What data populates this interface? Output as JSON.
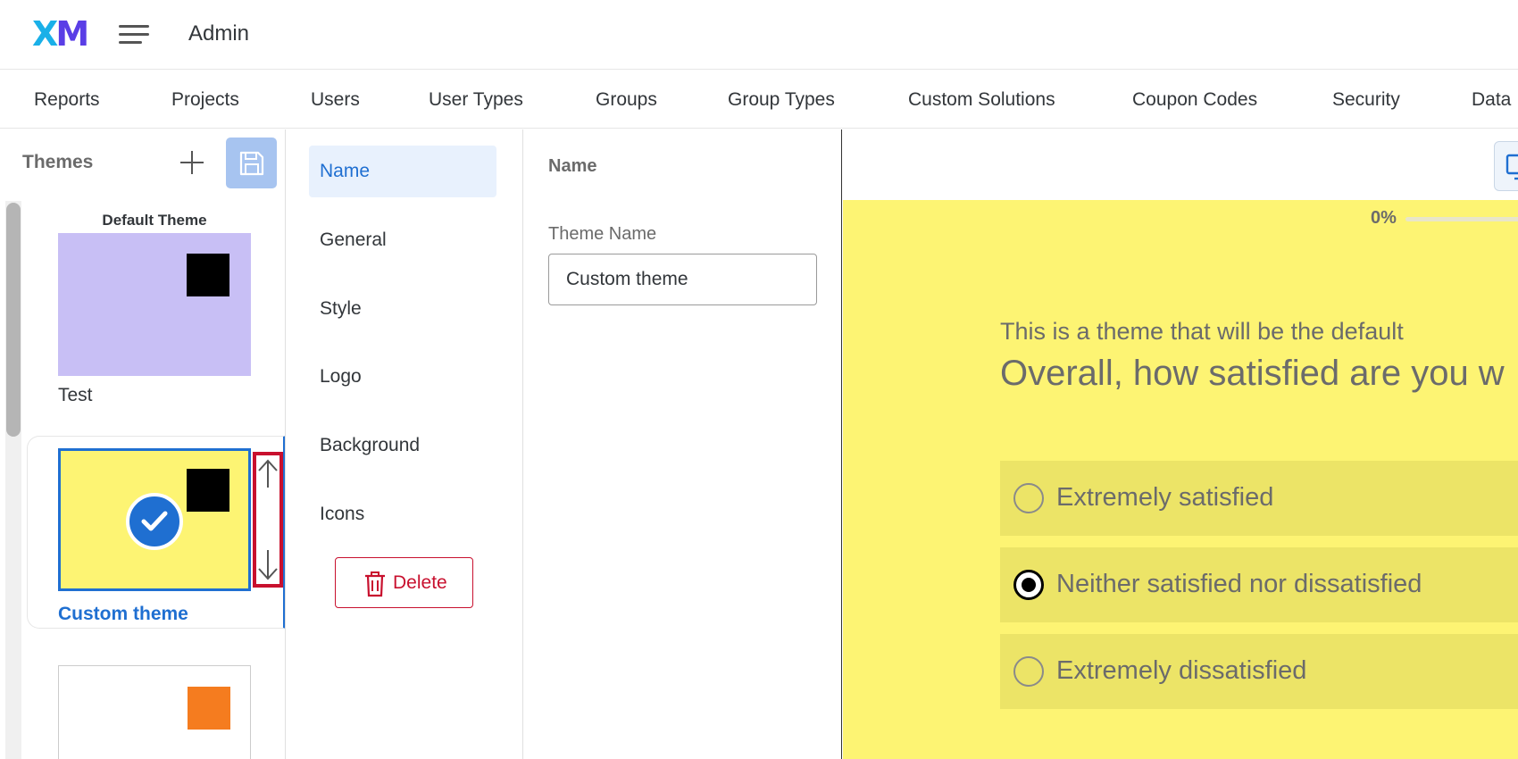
{
  "header": {
    "logo_x": "X",
    "logo_m": "M",
    "title": "Admin"
  },
  "nav": {
    "tabs": [
      "Reports",
      "Projects",
      "Users",
      "User Types",
      "Groups",
      "Group Types",
      "Custom Solutions",
      "Coupon Codes",
      "Security",
      "Data"
    ]
  },
  "themes": {
    "heading": "Themes",
    "items": [
      {
        "caption": "Default Theme",
        "name": "Test",
        "thumb_color": "#c8bff5",
        "square_color": "#000000"
      },
      {
        "name": "Custom theme",
        "thumb_color": "#fdf473",
        "square_color": "#000000",
        "selected": true
      },
      {
        "thumb_color": "#ffffff",
        "square_color": "#f57c1f"
      }
    ]
  },
  "settings_nav": {
    "items": [
      "Name",
      "General",
      "Style",
      "Logo",
      "Background",
      "Icons"
    ],
    "active": "Name",
    "delete_label": "Delete"
  },
  "name_panel": {
    "title": "Name",
    "field_label": "Theme Name",
    "field_value": "Custom theme"
  },
  "preview": {
    "progress_label": "0%",
    "progress": 0,
    "intro": "This is a theme that will be the default",
    "question": "Overall, how satisfied are you w",
    "choices": [
      {
        "label": "Extremely satisfied",
        "selected": false
      },
      {
        "label": "Neither satisfied nor dissatisfied",
        "selected": true
      },
      {
        "label": "Extremely dissatisfied",
        "selected": false
      }
    ]
  },
  "colors": {
    "accent": "#1f6fd1",
    "danger": "#c8102e",
    "preview_bg": "#fdf473"
  },
  "icons": {
    "menu": "hamburger-menu-icon",
    "add": "plus-icon",
    "save": "floppy-disk-icon",
    "check": "checkmark-icon",
    "reorder_up": "arrow-up-icon",
    "reorder_down": "arrow-down-icon",
    "delete": "trash-icon",
    "device": "desktop-monitor-icon"
  }
}
